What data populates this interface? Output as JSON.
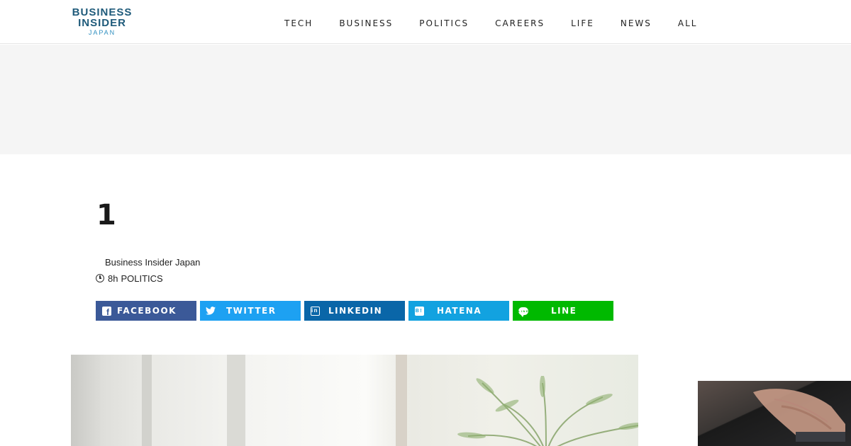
{
  "header": {
    "logo": {
      "line1": "BUSINESS",
      "line2": "INSIDER",
      "line3": "JAPAN",
      "color": "#1e5a7a"
    },
    "nav": [
      {
        "label": "TECH"
      },
      {
        "label": "BUSINESS"
      },
      {
        "label": "POLITICS"
      },
      {
        "label": "CAREERS"
      },
      {
        "label": "LIFE"
      },
      {
        "label": "NEWS"
      },
      {
        "label": "ALL"
      }
    ]
  },
  "article": {
    "title": "1",
    "author": "Business Insider Japan",
    "time": "8h",
    "category": "POLITICS",
    "icons": {
      "time": "clock-icon"
    }
  },
  "share": [
    {
      "label": "FACEBOOK",
      "icon": "facebook-icon",
      "color": "#3b5998"
    },
    {
      "label": "TWITTER",
      "icon": "twitter-icon",
      "color": "#1da1f2"
    },
    {
      "label": "LINKEDIN",
      "icon": "linkedin-icon",
      "color": "#0a66a8"
    },
    {
      "label": "HATENA",
      "icon": "hatena-bookmark-icon",
      "color": "#12a2e0"
    },
    {
      "label": "LINE",
      "icon": "line-icon",
      "color": "#00b900"
    }
  ],
  "glyphs": {
    "linkedin": "in",
    "hatena": "B!",
    "line": "LINE"
  }
}
